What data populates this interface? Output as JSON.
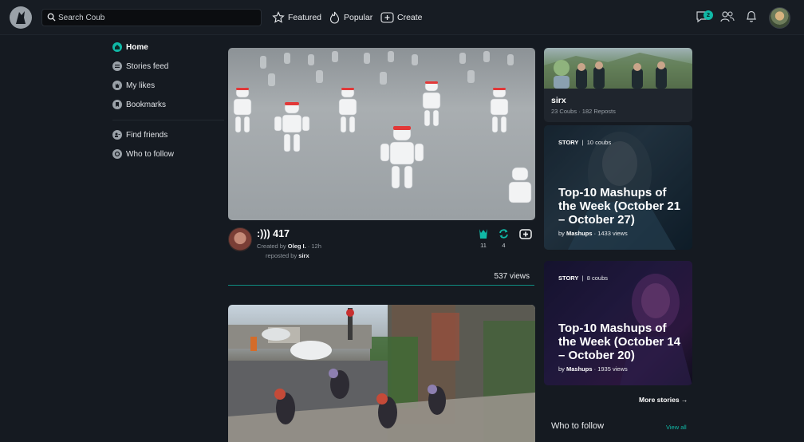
{
  "header": {
    "search_placeholder": "Search Coub",
    "nav": [
      "Featured",
      "Popular",
      "Create"
    ],
    "messages_badge": "2"
  },
  "sidebar": {
    "items": [
      {
        "label": "Home",
        "icon": "home-icon",
        "active": true
      },
      {
        "label": "Stories feed",
        "icon": "stories-icon"
      },
      {
        "label": "My likes",
        "icon": "likes-icon"
      },
      {
        "label": "Bookmarks",
        "icon": "bookmark-icon"
      }
    ],
    "secondary": [
      {
        "label": "Find friends",
        "icon": "find-friends-icon"
      },
      {
        "label": "Who to follow",
        "icon": "who-to-follow-icon"
      }
    ]
  },
  "feed": {
    "post": {
      "title": ":))) 417",
      "created_prefix": "Created by",
      "author": "Oleg I.",
      "age": "· 12h",
      "reposted_prefix": "reposted by",
      "reposter": "sirx",
      "likes": "11",
      "recoubs": "4",
      "views": "537 views"
    }
  },
  "right": {
    "profile": {
      "name": "sirx",
      "stats": "23 Coubs · 182 Reposts"
    },
    "stories": [
      {
        "tag": "STORY",
        "count": "10 coubs",
        "title": "Top-10 Mashups of the Week (October 21 – October 27)",
        "by_prefix": "by",
        "by": "Mashups",
        "views": "· 1433 views"
      },
      {
        "tag": "STORY",
        "count": "8 coubs",
        "title": "Top-10 Mashups of the Week (October 14 – October 20)",
        "by_prefix": "by",
        "by": "Mashups",
        "views": "· 1935 views"
      }
    ],
    "more_stories": "More stories →",
    "who_to_follow": "Who to follow",
    "view_all": "View all"
  },
  "colors": {
    "accent": "#10b8a6",
    "background": "#151a21"
  }
}
